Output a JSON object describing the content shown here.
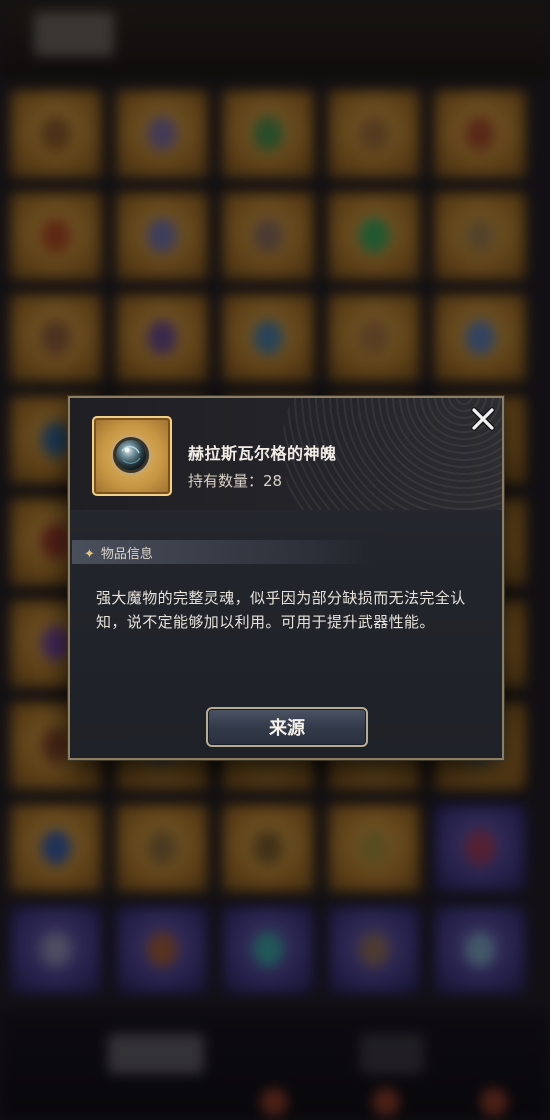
{
  "item": {
    "name": "赫拉斯瓦尔格的神魄",
    "count_label": "持有数量：",
    "count_value": "28"
  },
  "section": {
    "title": "物品信息"
  },
  "description": "强大魔物的完整灵魂，似乎因为部分缺损而无法完全认知，说不定能够加以利用。可用于提升武器性能。",
  "buttons": {
    "source_label": "来源"
  },
  "icons": {
    "close": "close-icon",
    "item": "soul-orb-icon",
    "section": "sparkle-icon"
  },
  "colors": {
    "modal_border": "#8b7e63",
    "item_frame_gold": "#c79644",
    "button_bg": "#323949"
  }
}
